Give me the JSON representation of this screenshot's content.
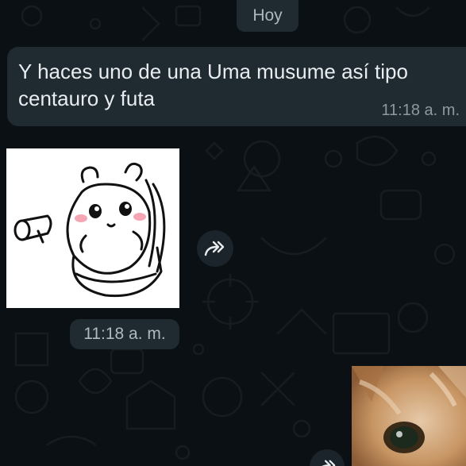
{
  "date_divider": {
    "label": "Hoy"
  },
  "messages": [
    {
      "type": "text",
      "text": "Y haces uno de una Uma musume así tipo centauro y futa",
      "time": "11:18 a. m."
    },
    {
      "type": "sticker",
      "sticker_icon": "bear-on-toilet-sticker",
      "time": "11:18 a. m.",
      "forward_icon": "forward-icon"
    },
    {
      "type": "image",
      "image_icon": "cat-photo",
      "forward_icon": "forward-icon"
    }
  ],
  "colors": {
    "background": "#0b1014",
    "bubble": "#1f2a31",
    "text": "#e9edef",
    "meta": "#8d989f"
  }
}
